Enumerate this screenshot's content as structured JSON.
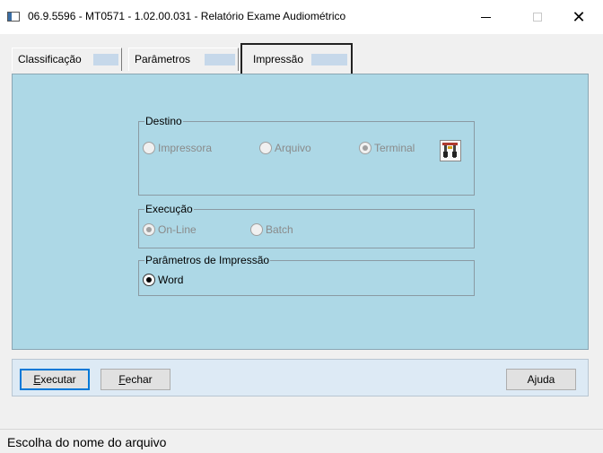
{
  "window": {
    "title": "06.9.5596 - MT0571 - 1.02.00.031 - Relatório Exame Audiométrico",
    "minimize_glyph": "—",
    "close_glyph": "✕"
  },
  "tabs": [
    {
      "label": "Classificação"
    },
    {
      "label": "Parâmetros"
    },
    {
      "label": "Impressão"
    }
  ],
  "destino": {
    "title": "Destino",
    "options": [
      "Impressora",
      "Arquivo",
      "Terminal"
    ],
    "selected": "Terminal",
    "icon": "printer-setup-icon"
  },
  "execucao": {
    "title": "Execução",
    "options": [
      "On-Line",
      "Batch"
    ],
    "selected": "On-Line"
  },
  "parametros_impressao": {
    "title": "Parâmetros de Impressão",
    "options": [
      "Word"
    ],
    "selected": "Word"
  },
  "buttons": {
    "executar": {
      "hotkey": "E",
      "rest": "xecutar"
    },
    "fechar": {
      "hotkey": "F",
      "rest": "echar"
    },
    "ajuda": {
      "prefix": "A",
      "hotkey": "j",
      "rest": "uda"
    }
  },
  "status": "Escolha do nome do arquivo",
  "colors": {
    "panel_bg": "#add8e6",
    "footer_bg": "#ddeaf5",
    "focus_border": "#0078d7"
  }
}
